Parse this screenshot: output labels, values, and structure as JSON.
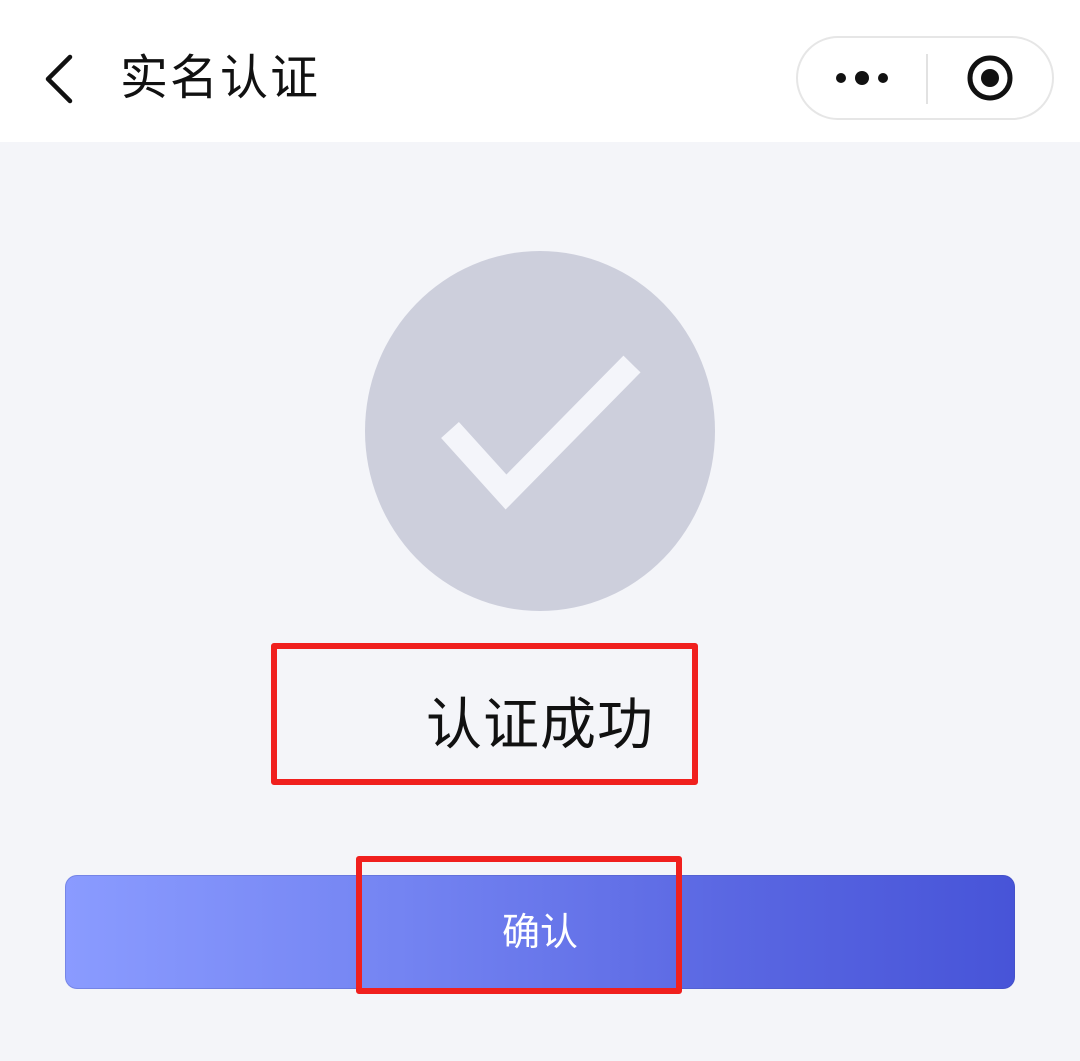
{
  "nav": {
    "title": "实名认证",
    "back_icon": "chevron-left-icon",
    "more_icon": "more-dots-icon",
    "close_icon": "target-circle-icon"
  },
  "result": {
    "icon": "check-circle-icon",
    "icon_color": "#cdcfdc",
    "message": "认证成功"
  },
  "actions": {
    "confirm_label": "确认"
  },
  "colors": {
    "page_bg": "#f4f5f9",
    "button_gradient_start": "#8a9bff",
    "button_gradient_end": "#4754d8",
    "highlight_border": "#f0201e"
  }
}
